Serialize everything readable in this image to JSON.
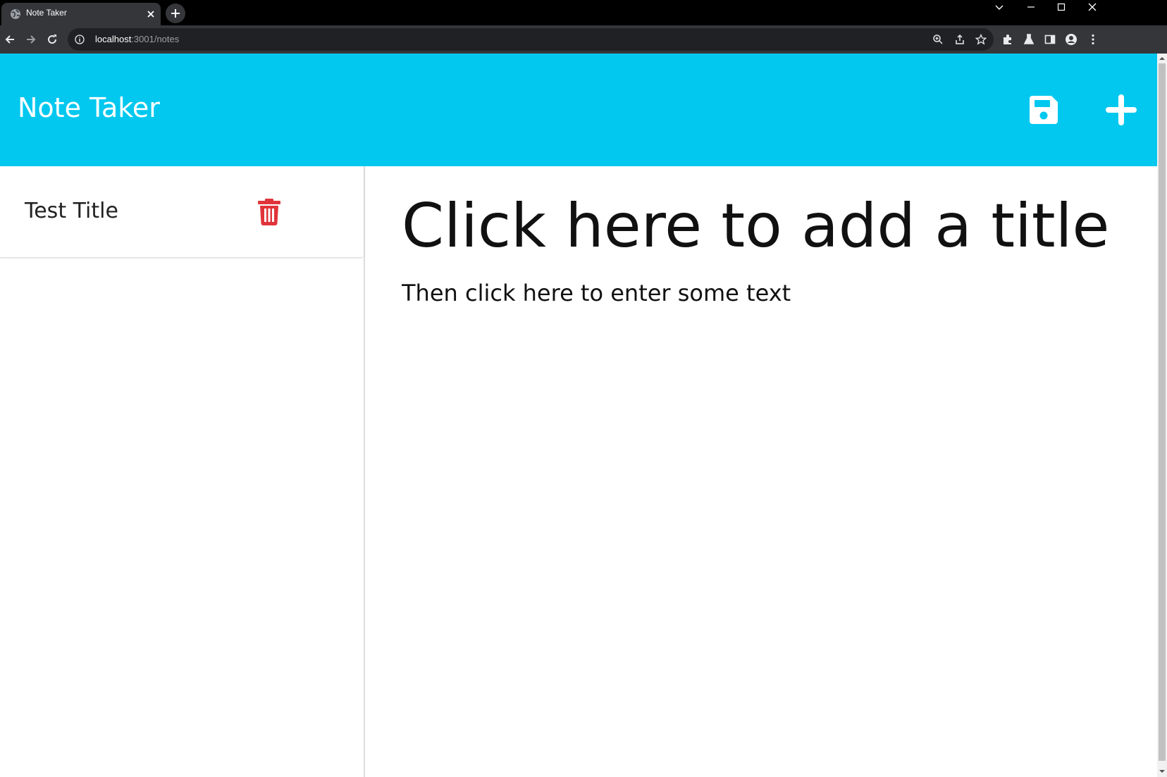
{
  "browser": {
    "tab_title": "Note Taker",
    "url_host": "localhost",
    "url_rest": ":3001/notes"
  },
  "app": {
    "brand": "Note Taker",
    "accent_color": "#02c8ef",
    "delete_color": "#e0343a"
  },
  "notes": [
    {
      "title": "Test Title"
    }
  ],
  "editor": {
    "title_placeholder": "Click here to add a title",
    "text_placeholder": "Then click here to enter some text"
  }
}
